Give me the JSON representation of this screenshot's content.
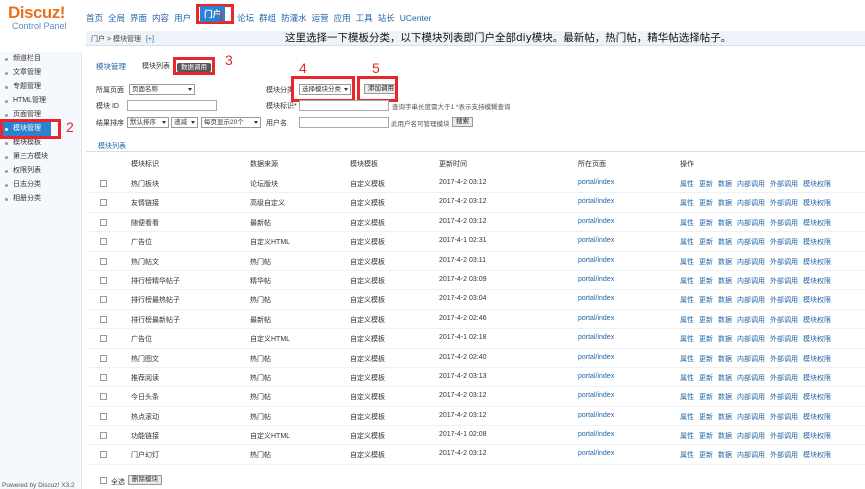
{
  "logo": {
    "brand": "Discuz!",
    "sub": "Control Panel"
  },
  "topnav": [
    "首页",
    "全局",
    "界面",
    "内容",
    "用户",
    "门户",
    "论坛",
    "群组",
    "防灌水",
    "运营",
    "应用",
    "工具",
    "站长",
    "UCenter"
  ],
  "annotations": {
    "n1": "1",
    "n2": "2",
    "n3": "3",
    "n4": "4",
    "n5": "5",
    "note": "这里选择一下模板分类，以下模块列表即门户全部diy模块。最新帖，热门帖，精华帖选择帖子。"
  },
  "sidebar": {
    "items": [
      "频道栏目",
      "文章管理",
      "专题管理",
      "HTML管理",
      "页面管理",
      "模块管理",
      "模块模板",
      "第三方模块",
      "权限列表",
      "日志分类",
      "相册分类"
    ],
    "powered": "Powered by Discuz! X3.2"
  },
  "breadcrumb": {
    "text": "门户 > 模块管理",
    "plus": "[+]"
  },
  "tabs": {
    "manage": "模块管理",
    "list": "模块列表",
    "data_call": "数据调用"
  },
  "filters": {
    "page_label": "所属页面",
    "page_select": "页面名称",
    "category_label": "模块分类",
    "category_select": "选择模块分类",
    "add_button": "添加调用",
    "id_label": "模块 ID",
    "mark_label": "模块标识*",
    "mark_hint": "查询字串长度需大于1  *表示支持模糊查询",
    "sort_label": "结果排序",
    "sort_select": "默认排序",
    "order_select": "递减",
    "perpage_select": "每页显示20个",
    "user_label": "用户名",
    "user_hint": "此用户名可管理模块",
    "search_button": "搜索"
  },
  "list_title": "模块列表",
  "columns": [
    "模块标识",
    "数据来源",
    "模块模板",
    "更新时间",
    "所在页面",
    "操作"
  ],
  "operations": [
    "属性",
    "更新",
    "数据",
    "内部调用",
    "外部调用",
    "模块权限"
  ],
  "rows": [
    [
      "热门板块",
      "论坛版块",
      "自定义模板",
      "2017-4-2 03:12",
      "portal/index"
    ],
    [
      "友情链接",
      "高级自定义",
      "自定义模板",
      "2017-4-2 03:12",
      "portal/index"
    ],
    [
      "随便看看",
      "最新帖",
      "自定义模板",
      "2017-4-2 03:12",
      "portal/index"
    ],
    [
      "广告位",
      "自定义HTML",
      "自定义模板",
      "2017-4-1 02:31",
      "portal/index"
    ],
    [
      "热门帖文",
      "热门帖",
      "自定义模板",
      "2017-4-2 03:11",
      "portal/index"
    ],
    [
      "排行榜精华帖子",
      "精华帖",
      "自定义模板",
      "2017-4-2 03:09",
      "portal/index"
    ],
    [
      "排行榜最热帖子",
      "热门帖",
      "自定义模板",
      "2017-4-2 03:04",
      "portal/index"
    ],
    [
      "排行榜最新帖子",
      "最新帖",
      "自定义模板",
      "2017-4-2 02:46",
      "portal/index"
    ],
    [
      "广告位",
      "自定义HTML",
      "自定义模板",
      "2017-4-1 02:18",
      "portal/index"
    ],
    [
      "热门图文",
      "热门帖",
      "自定义模板",
      "2017-4-2 02:40",
      "portal/index"
    ],
    [
      "推荐阅读",
      "热门帖",
      "自定义模板",
      "2017-4-2 03:13",
      "portal/index"
    ],
    [
      "今日头条",
      "热门帖",
      "自定义模板",
      "2017-4-2 03:12",
      "portal/index"
    ],
    [
      "热点滚动",
      "热门帖",
      "自定义模板",
      "2017-4-2 03:12",
      "portal/index"
    ],
    [
      "功能链接",
      "自定义HTML",
      "自定义模板",
      "2017-4-1 02:08",
      "portal/index"
    ],
    [
      "门户幻灯",
      "热门帖",
      "自定义模板",
      "2017-4-2 03:12",
      "portal/index"
    ]
  ],
  "footer": {
    "select_all": "全选",
    "delete_button": "删除模块"
  }
}
